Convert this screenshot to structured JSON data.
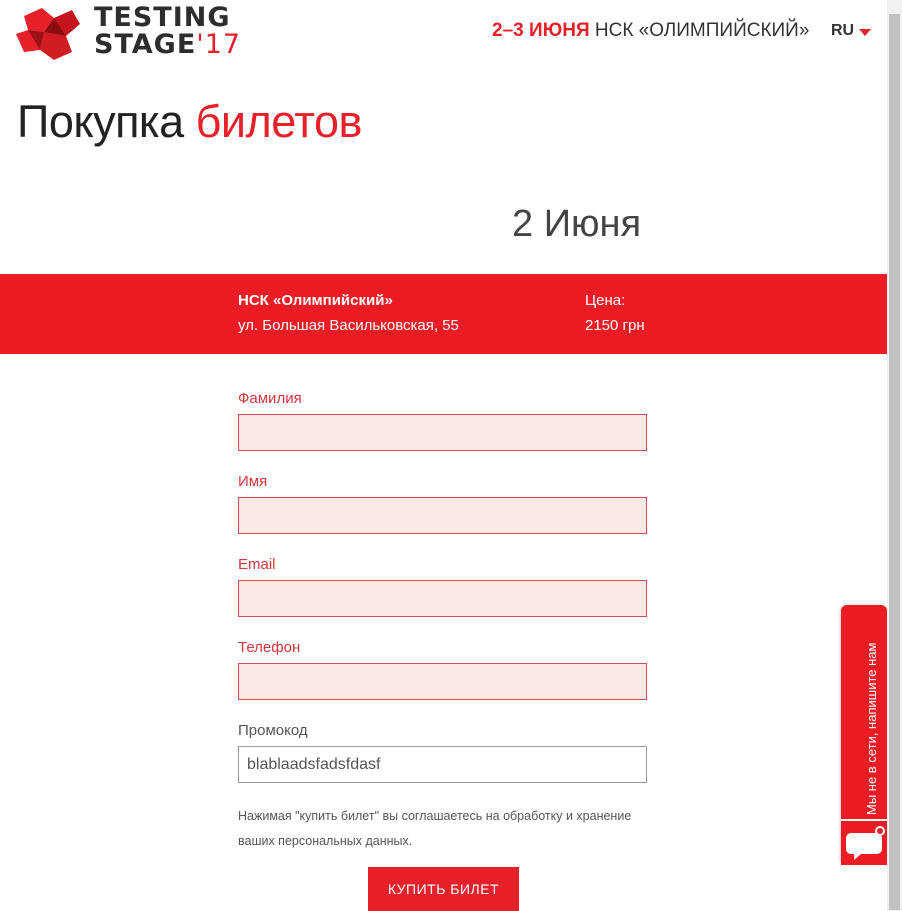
{
  "header": {
    "brand_line1": "TESTING",
    "brand_line2": "STAGE",
    "brand_year": "'17",
    "event_dates": "2–3 ИЮНЯ",
    "event_venue": "НСК «ОЛИМПИЙСКИЙ»",
    "language": "RU"
  },
  "page": {
    "title_main": "Покупка ",
    "title_accent": "билетов",
    "day": "2 Июня"
  },
  "ticket": {
    "venue_name": "НСК «Олимпийский»",
    "venue_address": "ул. Большая Васильковская, 55",
    "price_label": "Цена:",
    "price_value": "2150 грн"
  },
  "form": {
    "last_name_label": "Фамилия",
    "last_name_value": "",
    "first_name_label": "Имя",
    "first_name_value": "",
    "email_label": "Email",
    "email_value": "",
    "phone_label": "Телефон",
    "phone_value": "",
    "promo_label": "Промокод",
    "promo_value": "blablaadsfadsfdasf",
    "agreement_text": "Нажимая \"купить билет\" вы соглашаетесь на обработку и хранение ваших персональных данных.",
    "submit_label": "КУПИТЬ БИЛЕТ"
  },
  "chat": {
    "label": "Мы не в сети, напишите нам"
  },
  "colors": {
    "accent": "#ed1c24",
    "field_bg": "#fbe9e8"
  }
}
